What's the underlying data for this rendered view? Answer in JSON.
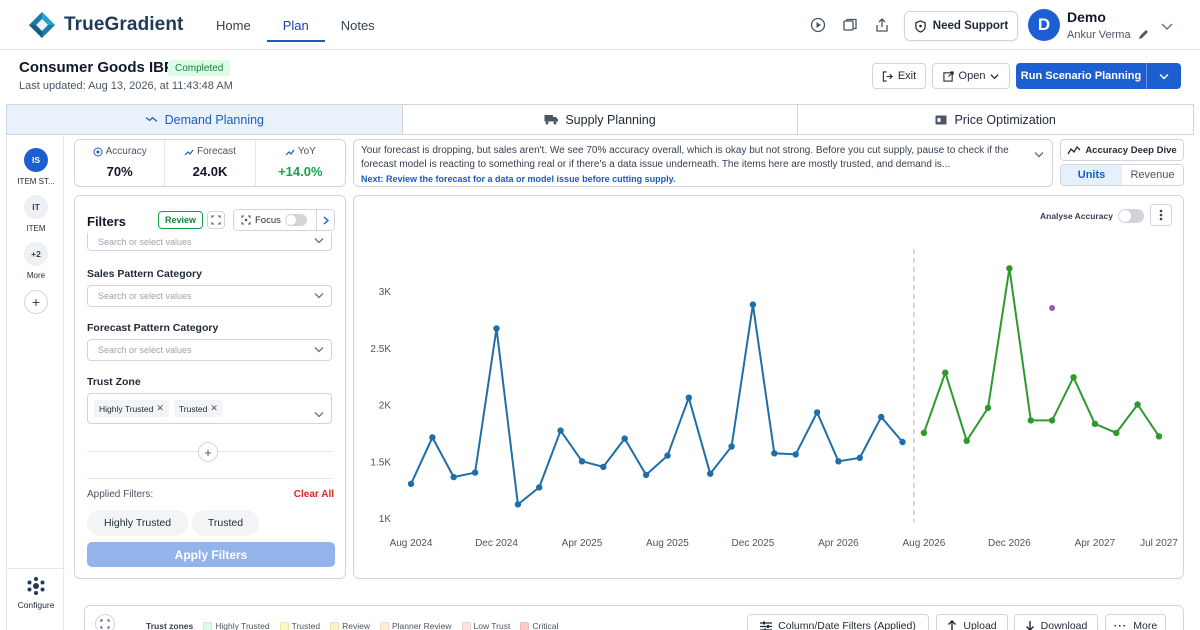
{
  "brand": {
    "name": "TrueGradient"
  },
  "nav": {
    "links": [
      "Home",
      "Plan",
      "Notes"
    ],
    "active": "Plan"
  },
  "topbar": {
    "support_label": "Need Support"
  },
  "user": {
    "initial": "D",
    "name": "Demo",
    "subname": "Ankur Verma"
  },
  "page": {
    "title": "Consumer Goods IBP",
    "status": "Completed",
    "updated": "Last updated: Aug 13, 2026, at 11:43:48 AM",
    "exit_label": "Exit",
    "open_label": "Open",
    "run_label": "Run Scenario Planning"
  },
  "modules": [
    {
      "label": "Demand Planning",
      "icon": "trend-icon"
    },
    {
      "label": "Supply Planning",
      "icon": "truck-icon"
    },
    {
      "label": "Price Optimization",
      "icon": "price-tag-icon"
    }
  ],
  "rail": {
    "items": [
      {
        "code": "IS",
        "label": "ITEM ST...",
        "active": true
      },
      {
        "code": "IT",
        "label": "ITEM",
        "active": false
      },
      {
        "code": "+2",
        "label": "More",
        "active": false
      }
    ],
    "configure_label": "Configure"
  },
  "kpis": {
    "accuracy": {
      "label": "Accuracy",
      "value": "70%"
    },
    "forecast": {
      "label": "Forecast",
      "value": "24.0K"
    },
    "yoy": {
      "label": "YoY",
      "value": "+14.0%"
    }
  },
  "insight": {
    "text": "Your forecast is dropping, but sales aren't. We see 70% accuracy overall, which is okay but not strong. Before you cut supply, pause to check if the forecast model is reacting to something real or if there's a data issue underneath. The items here are mostly trusted, and demand is...",
    "next": "Next: Review the forecast for a data or model issue before cutting supply."
  },
  "deep_dive_label": "Accuracy Deep Dive",
  "units_toggle": {
    "options": [
      "Units",
      "Revenue"
    ],
    "selected": "Units"
  },
  "filters": {
    "title": "Filters",
    "review_label": "Review",
    "focus_label": "Focus",
    "placeholder": "Search or select values",
    "sales_pattern_label": "Sales Pattern Category",
    "forecast_pattern_label": "Forecast Pattern Category",
    "trust_zone_label": "Trust Zone",
    "trust_zone_values": [
      "Highly Trusted",
      "Trusted"
    ],
    "applied_label": "Applied Filters:",
    "clear_all_label": "Clear All",
    "applied_pills": [
      "Highly Trusted",
      "Trusted"
    ],
    "apply_label": "Apply Filters"
  },
  "chart_toolbar": {
    "analyse_label": "Analyse Accuracy"
  },
  "bottom": {
    "trust_zones_label": "Trust zones",
    "zones": [
      {
        "label": "Highly Trusted",
        "color": "#dcfce7"
      },
      {
        "label": "Trusted",
        "color": "#fef9c3"
      },
      {
        "label": "Review",
        "color": "#fef3c7"
      },
      {
        "label": "Planner Review",
        "color": "#ffedd5"
      },
      {
        "label": "Low Trust",
        "color": "#fee2e2"
      },
      {
        "label": "Critical",
        "color": "#fecaca"
      }
    ],
    "column_filters_label": "Column/Date Filters (Applied)",
    "upload_label": "Upload",
    "download_label": "Download",
    "more_label": "More"
  },
  "chart_data": {
    "type": "line",
    "x_ticks": [
      "Aug 2024",
      "Dec 2024",
      "Apr 2025",
      "Aug 2025",
      "Dec 2025",
      "Apr 2026",
      "Aug 2026",
      "Dec 2026",
      "Apr 2027",
      "Jul 2027"
    ],
    "y_ticks": [
      "1K",
      "1.5K",
      "2K",
      "2.5K",
      "3K"
    ],
    "ylim": [
      1000,
      3000
    ],
    "x_start": "2024-08",
    "x_end": "2027-07",
    "divider_at": "2026-08",
    "colors": {
      "history": "#1f6ea8",
      "forecast": "#2e9a2e",
      "marker": "#9b59b6",
      "divider": "#c0c4cc"
    },
    "series": [
      {
        "name": "History",
        "points": [
          [
            "2024-08",
            1300
          ],
          [
            "2024-09",
            1710
          ],
          [
            "2024-10",
            1360
          ],
          [
            "2024-11",
            1400
          ],
          [
            "2024-12",
            2670
          ],
          [
            "2025-01",
            1120
          ],
          [
            "2025-02",
            1270
          ],
          [
            "2025-03",
            1770
          ],
          [
            "2025-04",
            1500
          ],
          [
            "2025-05",
            1450
          ],
          [
            "2025-06",
            1700
          ],
          [
            "2025-07",
            1380
          ],
          [
            "2025-08",
            1550
          ],
          [
            "2025-09",
            2060
          ],
          [
            "2025-10",
            1390
          ],
          [
            "2025-11",
            1630
          ],
          [
            "2025-12",
            2880
          ],
          [
            "2026-01",
            1570
          ],
          [
            "2026-02",
            1560
          ],
          [
            "2026-03",
            1930
          ],
          [
            "2026-04",
            1500
          ],
          [
            "2026-05",
            1530
          ],
          [
            "2026-06",
            1890
          ],
          [
            "2026-07",
            1670
          ]
        ]
      },
      {
        "name": "Forecast",
        "points": [
          [
            "2026-08",
            1750
          ],
          [
            "2026-09",
            2280
          ],
          [
            "2026-10",
            1680
          ],
          [
            "2026-11",
            1970
          ],
          [
            "2026-12",
            3200
          ],
          [
            "2027-01",
            1860
          ],
          [
            "2027-02",
            1860
          ],
          [
            "2027-03",
            2240
          ],
          [
            "2027-04",
            1830
          ],
          [
            "2027-05",
            1750
          ],
          [
            "2027-06",
            2000
          ],
          [
            "2027-07",
            1720
          ]
        ]
      },
      {
        "name": "Marker",
        "points": [
          [
            "2027-02",
            2850
          ]
        ]
      }
    ]
  }
}
